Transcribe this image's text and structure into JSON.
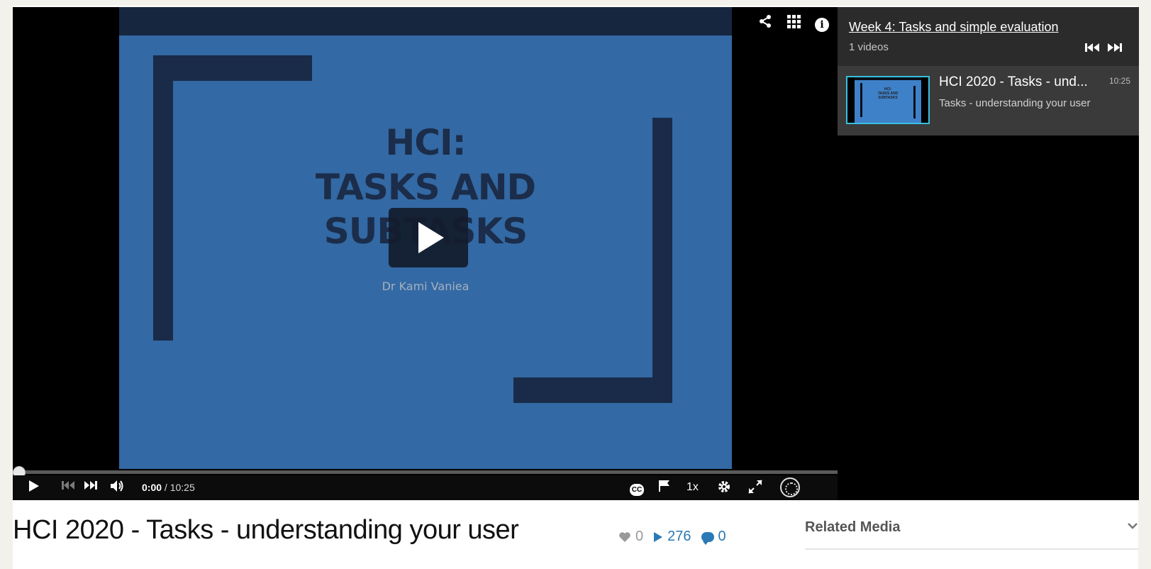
{
  "player": {
    "slide_title_line1": "HCI:",
    "slide_title_line2": "TASKS AND",
    "slide_title_line3": "SUBTASKS",
    "slide_author": "Dr Kami Vaniea",
    "current_time": "0:00",
    "duration": "/ 10:25",
    "speed": "1x",
    "cc_label": "CC",
    "progress_fraction": 0
  },
  "icons": {
    "share": "share-icon",
    "grid": "grid-icon",
    "info": "info-icon",
    "play": "play-icon",
    "prev": "previous-icon",
    "next": "next-icon",
    "volume": "volume-icon",
    "flag": "flag-icon",
    "settings": "gear-icon",
    "fullscreen": "fullscreen-icon"
  },
  "playlist": {
    "title": "Week 4: Tasks and simple evaluation",
    "count": "1 videos",
    "items": [
      {
        "title": "HCI 2020 - Tasks - und...",
        "duration": "10:25",
        "description": "Tasks - understanding your user"
      }
    ]
  },
  "media": {
    "title": "HCI 2020 - Tasks - understanding your user",
    "likes": "0",
    "plays": "276",
    "comments": "0"
  },
  "related": {
    "label": "Related Media"
  },
  "colors": {
    "slide_blue": "#3f81c8",
    "slide_dark": "#1f3558",
    "accent": "#2a7ab5",
    "thumb_border": "#37c0e0"
  }
}
